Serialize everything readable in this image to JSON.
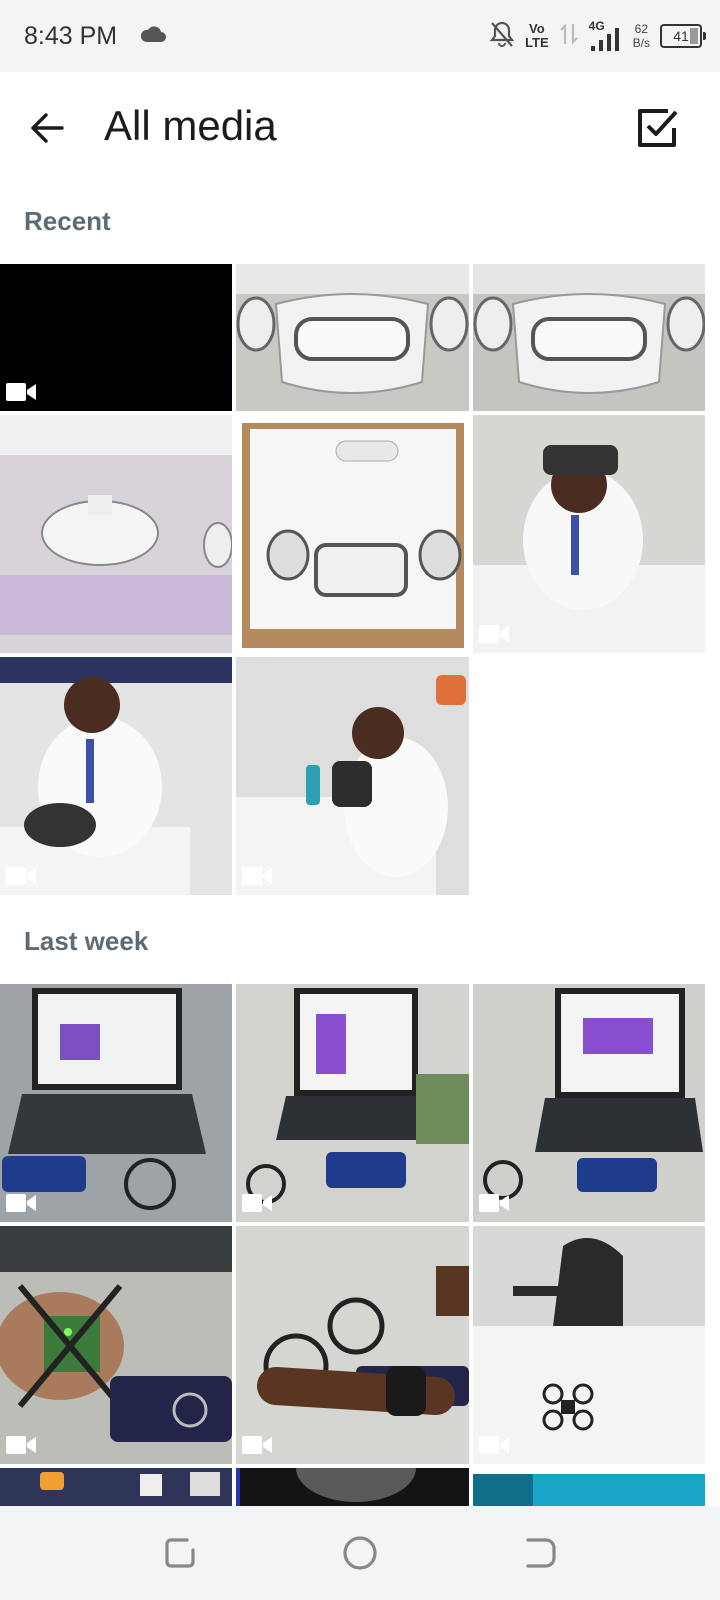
{
  "status_bar": {
    "time": "8:43 PM",
    "volte_top": "Vo",
    "volte_bottom": "LTE",
    "network": "4G",
    "speed_value": "62",
    "speed_unit": "B/s",
    "battery": "41",
    "icons": [
      "cloud-icon",
      "bell-muted-icon",
      "data-arrows-icon",
      "signal-icon",
      "battery-icon"
    ]
  },
  "app_bar": {
    "title": "All media",
    "back_icon": "arrow-left-icon",
    "select_icon": "checkbox-icon"
  },
  "sections": [
    {
      "label": "Recent",
      "items": [
        {
          "desc": "black video",
          "video": true,
          "bg": "#000000"
        },
        {
          "desc": "vr headset with controllers",
          "video": false,
          "bg": "#c8c8c4"
        },
        {
          "desc": "vr headset with controllers",
          "video": false,
          "bg": "#c4c4c0"
        },
        {
          "desc": "white vr headset on table",
          "video": false,
          "bg": "#d8d2da"
        },
        {
          "desc": "vr headset in box",
          "video": false,
          "bg": "#b48a5e"
        },
        {
          "desc": "person wearing vr headset",
          "video": true,
          "bg": "#d6d6d2"
        },
        {
          "desc": "person unboxing headset",
          "video": true,
          "bg": "#e4e4e6"
        },
        {
          "desc": "person holding headset",
          "video": true,
          "bg": "#dedede"
        }
      ]
    },
    {
      "label": "Last week",
      "items": [
        {
          "desc": "laptop and drone",
          "video": true,
          "bg": "#9ea3a8"
        },
        {
          "desc": "laptop and phone controller",
          "video": true,
          "bg": "#d2d2cf"
        },
        {
          "desc": "laptop and drone controller",
          "video": true,
          "bg": "#cfcfcc"
        },
        {
          "desc": "drone circuit board",
          "video": true,
          "bg": "#bdbdb8"
        },
        {
          "desc": "hand holding drone",
          "video": true,
          "bg": "#d5d5d2"
        },
        {
          "desc": "small drone on table",
          "video": true,
          "bg": "#e6e6e4"
        },
        {
          "desc": "wall with icons",
          "video": false,
          "bg": "#2e3558"
        },
        {
          "desc": "dark photo",
          "video": false,
          "bg": "#141414"
        },
        {
          "desc": "cyan photo",
          "video": false,
          "bg": "#1aa5c6"
        }
      ]
    }
  ],
  "nav_bar": {
    "icons": [
      "recents-icon",
      "home-icon",
      "back-icon"
    ]
  }
}
